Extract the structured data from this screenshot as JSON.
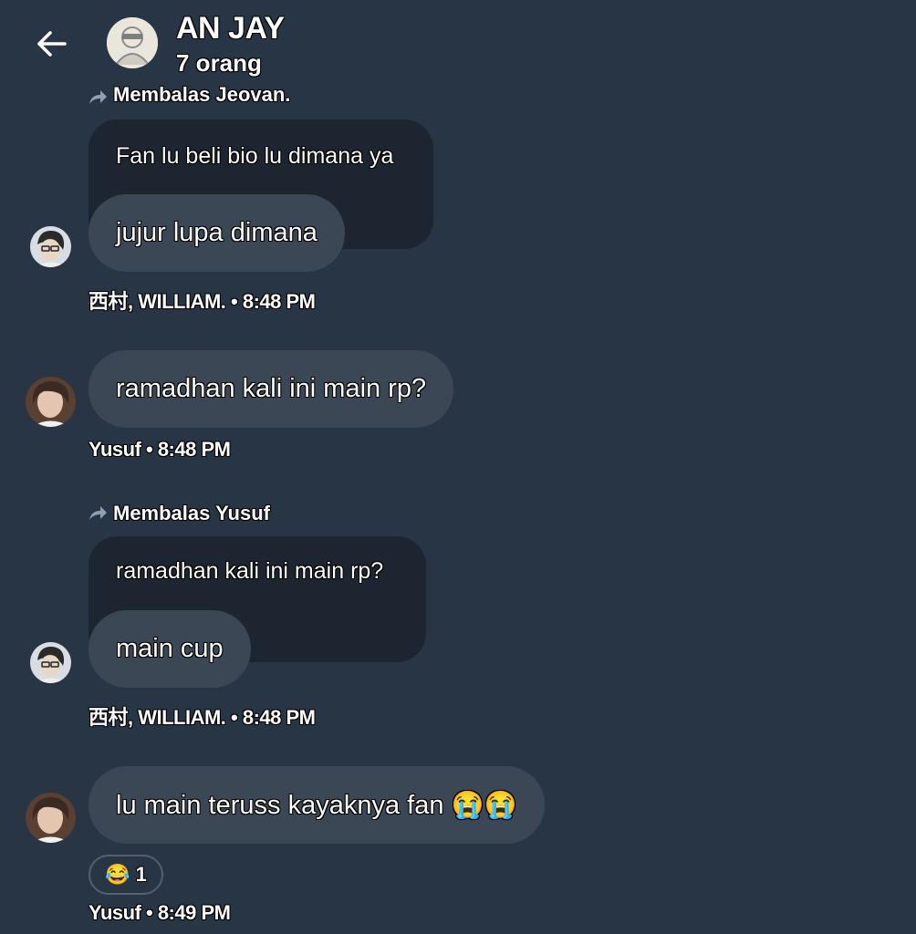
{
  "header": {
    "title": "AN JAY",
    "subtitle": "7 orang"
  },
  "messages": [
    {
      "reply_to": "Membalas Jeovan.",
      "quoted": "Fan lu beli bio lu dimana ya",
      "text": "jujur lupa dimana",
      "meta": "西村, WILLIAM. • 8:48 PM"
    },
    {
      "text": "ramadhan kali ini main rp?",
      "meta": "Yusuf • 8:48 PM"
    },
    {
      "reply_to": "Membalas Yusuf",
      "quoted": "ramadhan kali ini main rp?",
      "text": "main cup",
      "meta": "西村, WILLIAM. • 8:48 PM"
    },
    {
      "text": "lu main teruss kayaknya fan 😭😭",
      "reaction": {
        "emoji": "😂",
        "count": "1"
      },
      "meta": "Yusuf • 8:49 PM"
    }
  ],
  "colors": {
    "background": "#273545",
    "bubble": "#3b4755",
    "quoted_bubble": "#1c2530"
  }
}
